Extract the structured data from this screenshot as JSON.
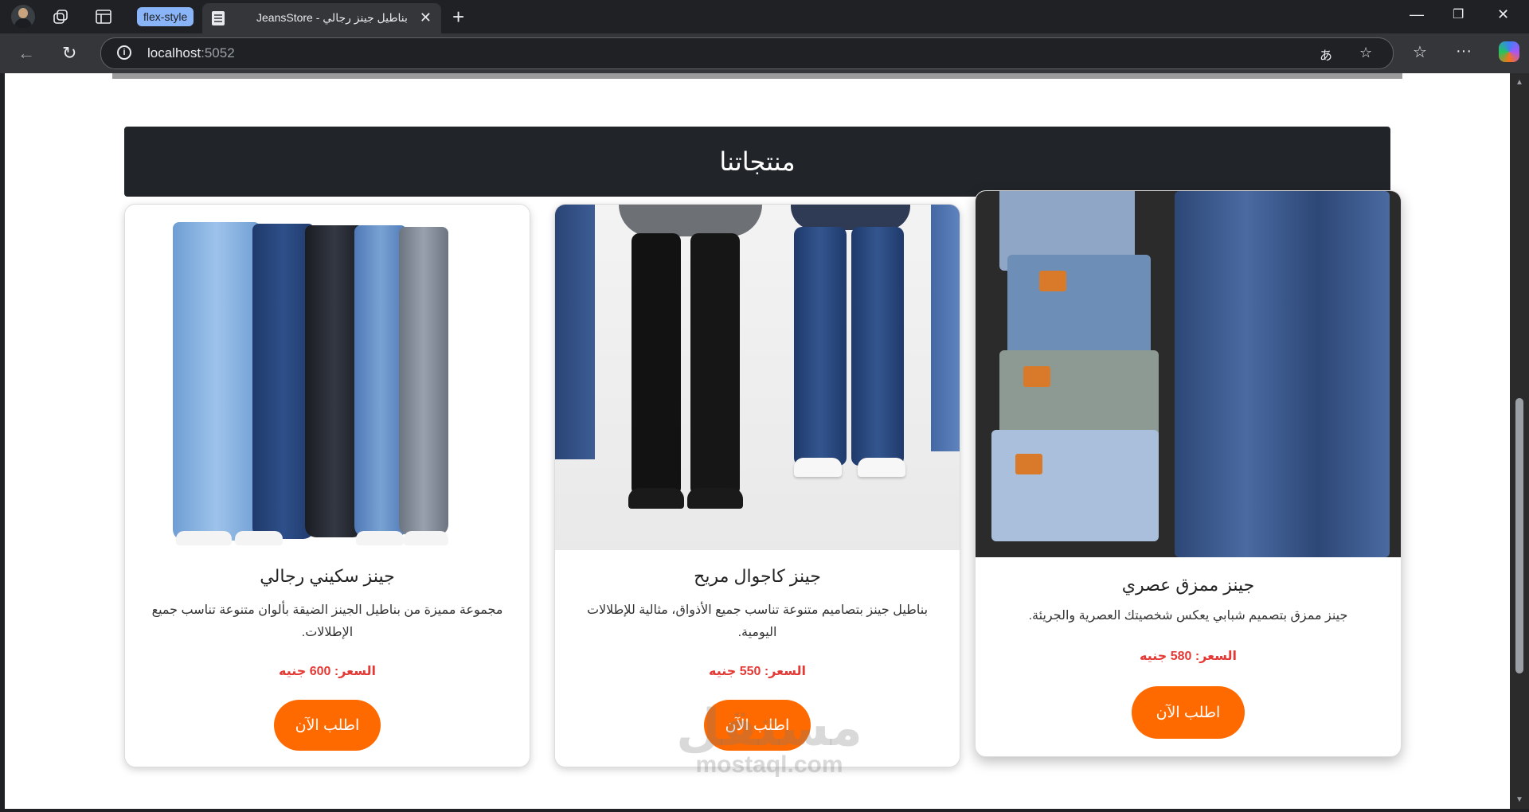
{
  "browser": {
    "tab_group_label": "flex-style",
    "tab_title": "JeansStore - بناطيل جينز رجالي",
    "url_host": "localhost",
    "url_port": ":5052"
  },
  "page": {
    "section_title": "منتجاتنا",
    "products": [
      {
        "name": "جينز سكيني رجالي",
        "description": "مجموعة مميزة من بناطيل الجينز الضيقة بألوان متنوعة تناسب جميع الإطلالات.",
        "price": "السعر: 600 جنيه",
        "button": "اطلب الآن"
      },
      {
        "name": "جينز كاجوال مريح",
        "description": "بناطيل جينز بتصاميم متنوعة تناسب جميع الأذواق، مثالية للإطلالات اليومية.",
        "price": "السعر: 550 جنيه",
        "button": "اطلب الآن"
      },
      {
        "name": "جينز ممزق عصري",
        "description": "جينز ممزق بتصميم شبابي يعكس شخصيتك العصرية والجريئة.",
        "price": "السعر: 580 جنيه",
        "button": "اطلب الآن"
      }
    ],
    "watermark_ar": "مستقل",
    "watermark_en": "mostaql.com"
  },
  "colors": {
    "accent": "#ff6a00",
    "price": "#e53935",
    "header_bg": "#212529"
  },
  "icons": [
    "profile-avatar",
    "workspaces-icon",
    "tab-actions-icon",
    "page-favicon",
    "close-icon",
    "new-tab-icon",
    "minimize-icon",
    "maximize-icon",
    "close-window-icon",
    "back-icon",
    "reload-icon",
    "info-icon",
    "read-aloud-icon",
    "favorite-star-icon",
    "favorites-icon",
    "more-icon",
    "copilot-icon"
  ]
}
